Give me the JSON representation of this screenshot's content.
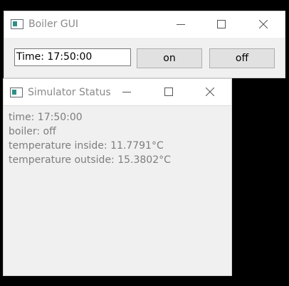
{
  "boiler_window": {
    "title": "Boiler GUI",
    "time_field_value": "Time: 17:50:00",
    "on_button_label": "on",
    "off_button_label": "off"
  },
  "simulator_window": {
    "title": "Simulator Status",
    "lines": [
      "time: 17:50:00",
      "boiler: off",
      "temperature inside: 11.7791°C",
      "temperature outside: 15.3802°C"
    ]
  },
  "icons": {
    "app": "window-app-icon",
    "minimize": "minimize-icon",
    "maximize": "maximize-icon",
    "close": "close-icon"
  }
}
